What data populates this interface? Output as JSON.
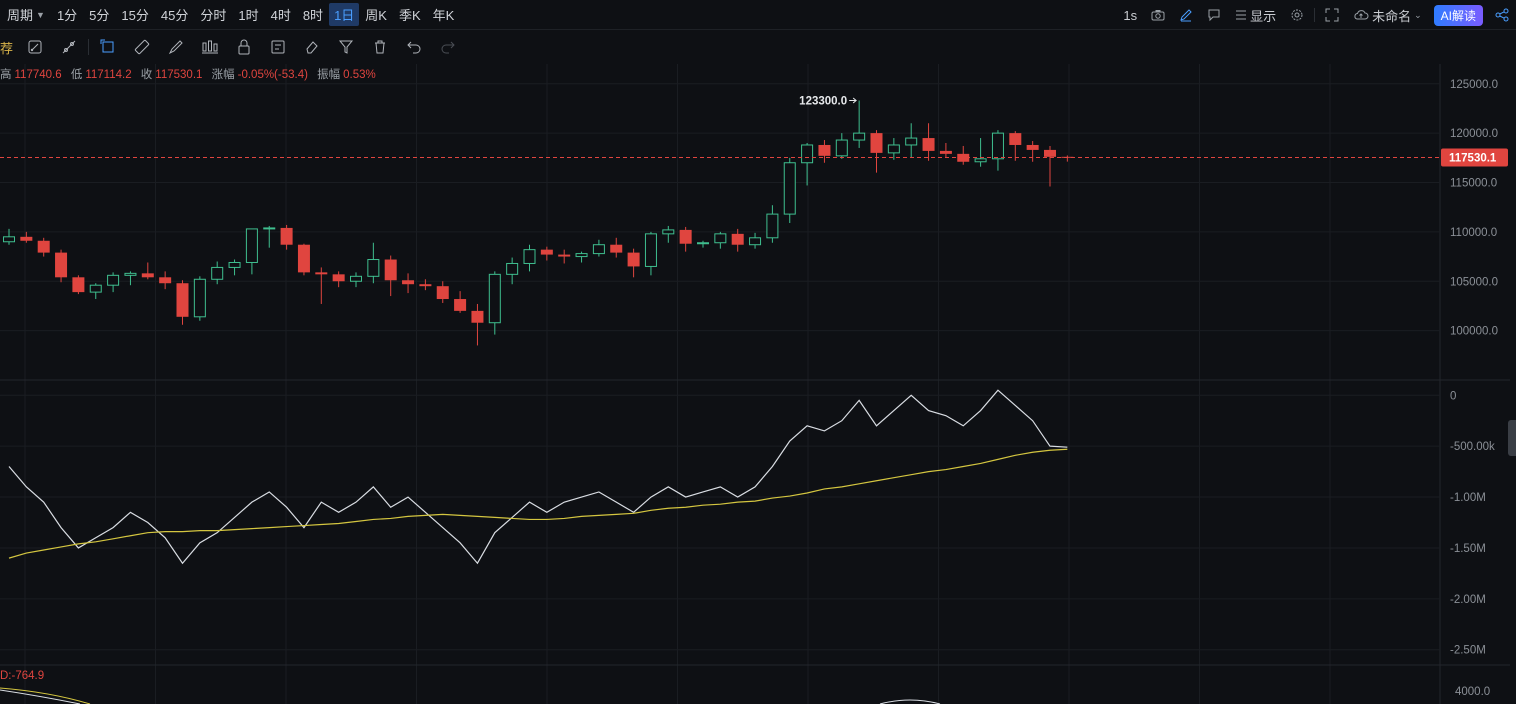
{
  "topbar": {
    "period_label": "周期",
    "timeframes": [
      "1分",
      "5分",
      "15分",
      "45分",
      "分时",
      "1时",
      "4时",
      "8时",
      "1日",
      "周K",
      "季K",
      "年K"
    ],
    "active_timeframe": "1日",
    "interval": "1s",
    "display_label": "显示",
    "layout_name": "未命名",
    "ai_label": "AI解读"
  },
  "toolbar": {
    "first_glyph": "荐"
  },
  "info_bar": {
    "high_label": "高",
    "high": "117740.6",
    "low_label": "低",
    "low": "117114.2",
    "close_label": "收",
    "close": "117530.1",
    "change_label": "涨幅",
    "change": "-0.05%(-53.4)",
    "amp_label": "振幅",
    "amp": "0.53%"
  },
  "macd_label": "D:-764.9",
  "chart_data": [
    {
      "type": "candlestick",
      "yaxis_ticks": [
        "125000.0",
        "120000.0",
        "115000.0",
        "110000.0",
        "105000.0",
        "100000.0"
      ],
      "ylim": [
        95000,
        127000
      ],
      "current_price": "117530.1",
      "high_annotation": "123300.0",
      "ohlc": [
        [
          109000,
          110300,
          108700,
          109500
        ],
        [
          109500,
          110000,
          108900,
          109100
        ],
        [
          109100,
          109400,
          107500,
          107900
        ],
        [
          107900,
          108200,
          104900,
          105400
        ],
        [
          105400,
          105600,
          103700,
          103900
        ],
        [
          103900,
          104800,
          103200,
          104600
        ],
        [
          104600,
          105900,
          103900,
          105600
        ],
        [
          105600,
          106000,
          104600,
          105800
        ],
        [
          105800,
          106900,
          105200,
          105400
        ],
        [
          105400,
          106000,
          104200,
          104800
        ],
        [
          104800,
          105100,
          100600,
          101400
        ],
        [
          101400,
          105500,
          101000,
          105200
        ],
        [
          105200,
          107000,
          104700,
          106400
        ],
        [
          106400,
          107200,
          105600,
          106900
        ],
        [
          106900,
          110300,
          105700,
          110300
        ],
        [
          110300,
          110600,
          108400,
          110400
        ],
        [
          110400,
          110700,
          108200,
          108700
        ],
        [
          108700,
          108800,
          105600,
          105900
        ],
        [
          105900,
          106400,
          102700,
          105700
        ],
        [
          105700,
          106000,
          104400,
          105000
        ],
        [
          105000,
          105900,
          104400,
          105500
        ],
        [
          105500,
          108900,
          104800,
          107200
        ],
        [
          107200,
          107600,
          103500,
          105100
        ],
        [
          105100,
          105800,
          103800,
          104700
        ],
        [
          104700,
          105200,
          104100,
          104500
        ],
        [
          104500,
          105000,
          102800,
          103200
        ],
        [
          103200,
          104000,
          101800,
          102000
        ],
        [
          102000,
          102700,
          98500,
          100800
        ],
        [
          100800,
          106000,
          99600,
          105700
        ],
        [
          105700,
          107400,
          104700,
          106800
        ],
        [
          106800,
          108700,
          106000,
          108200
        ],
        [
          108200,
          108500,
          107100,
          107700
        ],
        [
          107700,
          108200,
          106800,
          107500
        ],
        [
          107500,
          108000,
          106900,
          107800
        ],
        [
          107800,
          109200,
          107500,
          108700
        ],
        [
          108700,
          109400,
          107400,
          107900
        ],
        [
          107900,
          108300,
          105400,
          106500
        ],
        [
          106500,
          110000,
          105600,
          109800
        ],
        [
          109800,
          110600,
          108900,
          110200
        ],
        [
          110200,
          110500,
          108000,
          108800
        ],
        [
          108800,
          109100,
          108400,
          108900
        ],
        [
          108900,
          110000,
          108300,
          109800
        ],
        [
          109800,
          110300,
          108000,
          108700
        ],
        [
          108700,
          109900,
          108300,
          109400
        ],
        [
          109400,
          112700,
          108900,
          111800
        ],
        [
          111800,
          117500,
          110900,
          117000
        ],
        [
          117000,
          119000,
          114700,
          118800
        ],
        [
          118800,
          119300,
          117000,
          117700
        ],
        [
          117700,
          120000,
          117400,
          119300
        ],
        [
          119300,
          123300,
          118500,
          120000
        ],
        [
          120000,
          120300,
          116000,
          118000
        ],
        [
          118000,
          119500,
          117300,
          118800
        ],
        [
          118800,
          121000,
          117500,
          119500
        ],
        [
          119500,
          121000,
          117200,
          118200
        ],
        [
          118200,
          119000,
          117500,
          117900
        ],
        [
          117900,
          118700,
          116800,
          117100
        ],
        [
          117100,
          119500,
          116600,
          117400
        ],
        [
          117400,
          120300,
          116200,
          120000
        ],
        [
          120000,
          120200,
          117200,
          118800
        ],
        [
          118800,
          119200,
          117100,
          118300
        ],
        [
          118300,
          118700,
          114600,
          117600
        ],
        [
          117600,
          117740.6,
          117114.2,
          117530.1
        ]
      ]
    },
    {
      "type": "line",
      "yaxis_ticks": [
        "0",
        "-500.00k",
        "-1.00M",
        "-1.50M",
        "-2.00M",
        "-2.50M"
      ],
      "ylim": [
        -2650000,
        150000
      ],
      "series": [
        {
          "color": "#d9dde3",
          "values": [
            -700000,
            -900000,
            -1050000,
            -1300000,
            -1500000,
            -1400000,
            -1300000,
            -1150000,
            -1250000,
            -1400000,
            -1650000,
            -1450000,
            -1350000,
            -1200000,
            -1050000,
            -950000,
            -1100000,
            -1300000,
            -1050000,
            -1150000,
            -1050000,
            -900000,
            -1100000,
            -1000000,
            -1150000,
            -1300000,
            -1450000,
            -1650000,
            -1350000,
            -1200000,
            -1050000,
            -1150000,
            -1050000,
            -1000000,
            -950000,
            -1050000,
            -1150000,
            -1000000,
            -900000,
            -1000000,
            -950000,
            -900000,
            -1000000,
            -900000,
            -700000,
            -450000,
            -300000,
            -350000,
            -250000,
            -50000,
            -300000,
            -150000,
            0,
            -150000,
            -200000,
            -300000,
            -150000,
            50000,
            -100000,
            -250000,
            -500000,
            -510000
          ]
        },
        {
          "color": "#d4c640",
          "values": [
            -1600000,
            -1550000,
            -1520000,
            -1490000,
            -1460000,
            -1440000,
            -1410000,
            -1380000,
            -1350000,
            -1340000,
            -1340000,
            -1330000,
            -1330000,
            -1320000,
            -1310000,
            -1300000,
            -1290000,
            -1280000,
            -1270000,
            -1260000,
            -1240000,
            -1220000,
            -1210000,
            -1190000,
            -1180000,
            -1170000,
            -1180000,
            -1190000,
            -1200000,
            -1210000,
            -1220000,
            -1220000,
            -1210000,
            -1190000,
            -1180000,
            -1170000,
            -1160000,
            -1130000,
            -1110000,
            -1100000,
            -1080000,
            -1070000,
            -1050000,
            -1040000,
            -1010000,
            -990000,
            -960000,
            -920000,
            -900000,
            -870000,
            -840000,
            -810000,
            -780000,
            -750000,
            -730000,
            -700000,
            -670000,
            -630000,
            -590000,
            -560000,
            -540000,
            -530000
          ]
        }
      ]
    }
  ],
  "macd_axis_top_tick": "4000.0"
}
